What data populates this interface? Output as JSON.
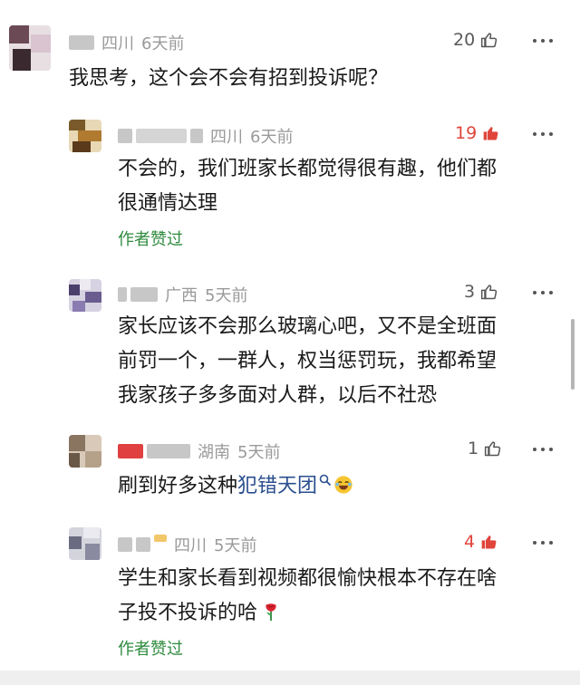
{
  "comments": [
    {
      "location": "四川",
      "time": "6天前",
      "likes": "20",
      "liked": false,
      "text": "我思考，这个会不会有招到投诉呢？",
      "author_liked": ""
    },
    {
      "location": "四川",
      "time": "6天前",
      "likes": "19",
      "liked": true,
      "text_line1": "不会的，我们班家长都觉得很有趣，他们都",
      "text_line2": "很通情达理",
      "author_liked": "作者赞过"
    },
    {
      "location": "广西",
      "time": "5天前",
      "likes": "3",
      "liked": false,
      "text_line1": "家长应该不会那么玻璃心吧，又不是全班面",
      "text_line2": "前罚一个，一群人，权当惩罚玩，我都希望",
      "text_line3": "我家孩子多多面对人群，以后不社恐",
      "author_liked": ""
    },
    {
      "location": "湖南",
      "time": "5天前",
      "likes": "1",
      "liked": false,
      "text_prefix": "刷到好多这种",
      "link_text": "犯错天团",
      "author_liked": ""
    },
    {
      "location": "四川",
      "time": "5天前",
      "likes": "4",
      "liked": true,
      "text_line1": "学生和家长看到视频都很愉快根本不存在啥",
      "text_line2": "子投不投诉的哈",
      "author_liked": "作者赞过"
    }
  ],
  "icons": {
    "like": "thumbs-up-icon",
    "more": "more-dots-icon",
    "search": "search-icon",
    "emoji_laugh": "laughing-emoji-icon",
    "emoji_rose": "rose-emoji-icon"
  },
  "colors": {
    "liked_red": "#e0453c",
    "author_green": "#2e8b3e",
    "link_blue": "#2a4f8f"
  }
}
